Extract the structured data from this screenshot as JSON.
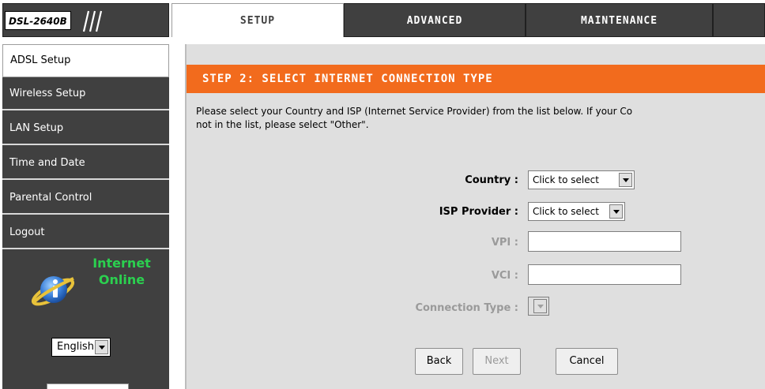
{
  "header": {
    "model": "DSL-2640B",
    "tabs": [
      {
        "label": "SETUP",
        "active": true
      },
      {
        "label": "ADVANCED",
        "active": false
      },
      {
        "label": "MAINTENANCE",
        "active": false
      }
    ]
  },
  "sidebar": {
    "items": [
      {
        "label": "ADSL Setup",
        "active": true
      },
      {
        "label": "Wireless Setup",
        "active": false
      },
      {
        "label": "LAN Setup",
        "active": false
      },
      {
        "label": "Time and Date",
        "active": false
      },
      {
        "label": "Parental Control",
        "active": false
      },
      {
        "label": "Logout",
        "active": false
      }
    ],
    "status": {
      "line1": "Internet",
      "line2": "Online",
      "icon": "info-icon"
    },
    "language": "English"
  },
  "main": {
    "section_title": "STEP 2: SELECT INTERNET CONNECTION TYPE",
    "description_line1": "Please select your Country and ISP (Internet Service Provider) from the list below. If your Co",
    "description_line2": "not in the list, please select \"Other\".",
    "form": {
      "country_label": "Country :",
      "country_value": "Click to select",
      "isp_label": "ISP Provider :",
      "isp_value": "Click to select",
      "vpi_label": "VPI :",
      "vpi_value": "",
      "vci_label": "VCI :",
      "vci_value": "",
      "connection_type_label": "Connection Type :",
      "connection_type_value": ""
    },
    "buttons": {
      "back": "Back",
      "next": "Next",
      "cancel": "Cancel"
    }
  },
  "colors": {
    "dark_bg": "#404040",
    "accent_orange": "#f26b1d",
    "status_green": "#2bd04f",
    "content_bg": "#dfdfdf"
  }
}
